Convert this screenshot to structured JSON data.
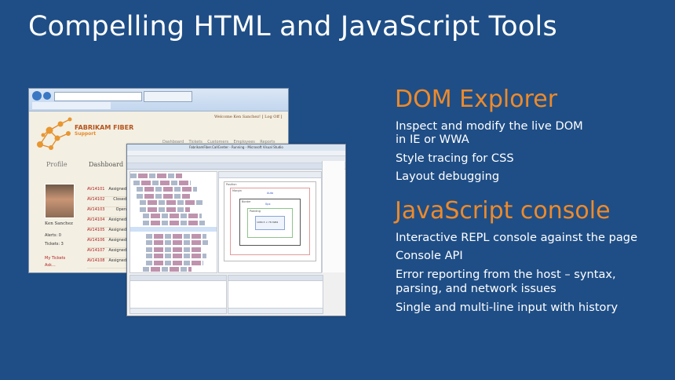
{
  "slide": {
    "title": "Compelling HTML and JavaScript Tools",
    "sections": [
      {
        "heading": "DOM Explorer",
        "bullets": [
          "Inspect and modify the live DOM",
          "in IE or WWA",
          "Style tracing for CSS",
          "Layout debugging"
        ]
      },
      {
        "heading": "JavaScript console",
        "bullets": [
          "Interactive REPL console against the page",
          "Console API",
          "Error reporting from the host – syntax,",
          "parsing, and network issues",
          "Single and multi-line input with history"
        ]
      }
    ]
  },
  "browser_shot": {
    "logo_text": "FABRIKAM FIBER",
    "logo_sub": "Support",
    "welcome": "Welcome Ken Sanchez! [ Log Off ]",
    "nav": [
      "Dashboard",
      "Tickets",
      "Customers",
      "Employees",
      "Reports"
    ],
    "profile_label": "Profile",
    "dashboard_label": "Dashboard",
    "person_name": "Ken Sanchez",
    "stats": [
      "Alerts:  0",
      "Tickets:  3"
    ],
    "links": [
      "My Tickets",
      "Ask..."
    ],
    "tickets": [
      {
        "id": "AV14101",
        "status": "Assigned"
      },
      {
        "id": "AV14102",
        "status": "Closed"
      },
      {
        "id": "AV14103",
        "status": "Open"
      },
      {
        "id": "AV14104",
        "status": "Assigned"
      },
      {
        "id": "AV14105",
        "status": "Assigned"
      },
      {
        "id": "AV14106",
        "status": "Assigned"
      },
      {
        "id": "AV14107",
        "status": "Assigned"
      },
      {
        "id": "AV14108",
        "status": "Assigned"
      }
    ]
  },
  "devtools_shot": {
    "window_title": "FabrikamFiber.CallCenter - Running - Microsoft Visual Studio",
    "box_model": {
      "position": "Position",
      "margin": "Margin",
      "border": "Border",
      "padding": "Padding",
      "content": "1084.5 × 78.3984",
      "auto": "Auto",
      "zero": "0px"
    }
  },
  "colors": {
    "background": "#1f4e86",
    "heading": "#ee8a2a",
    "text": "#ffffff"
  }
}
